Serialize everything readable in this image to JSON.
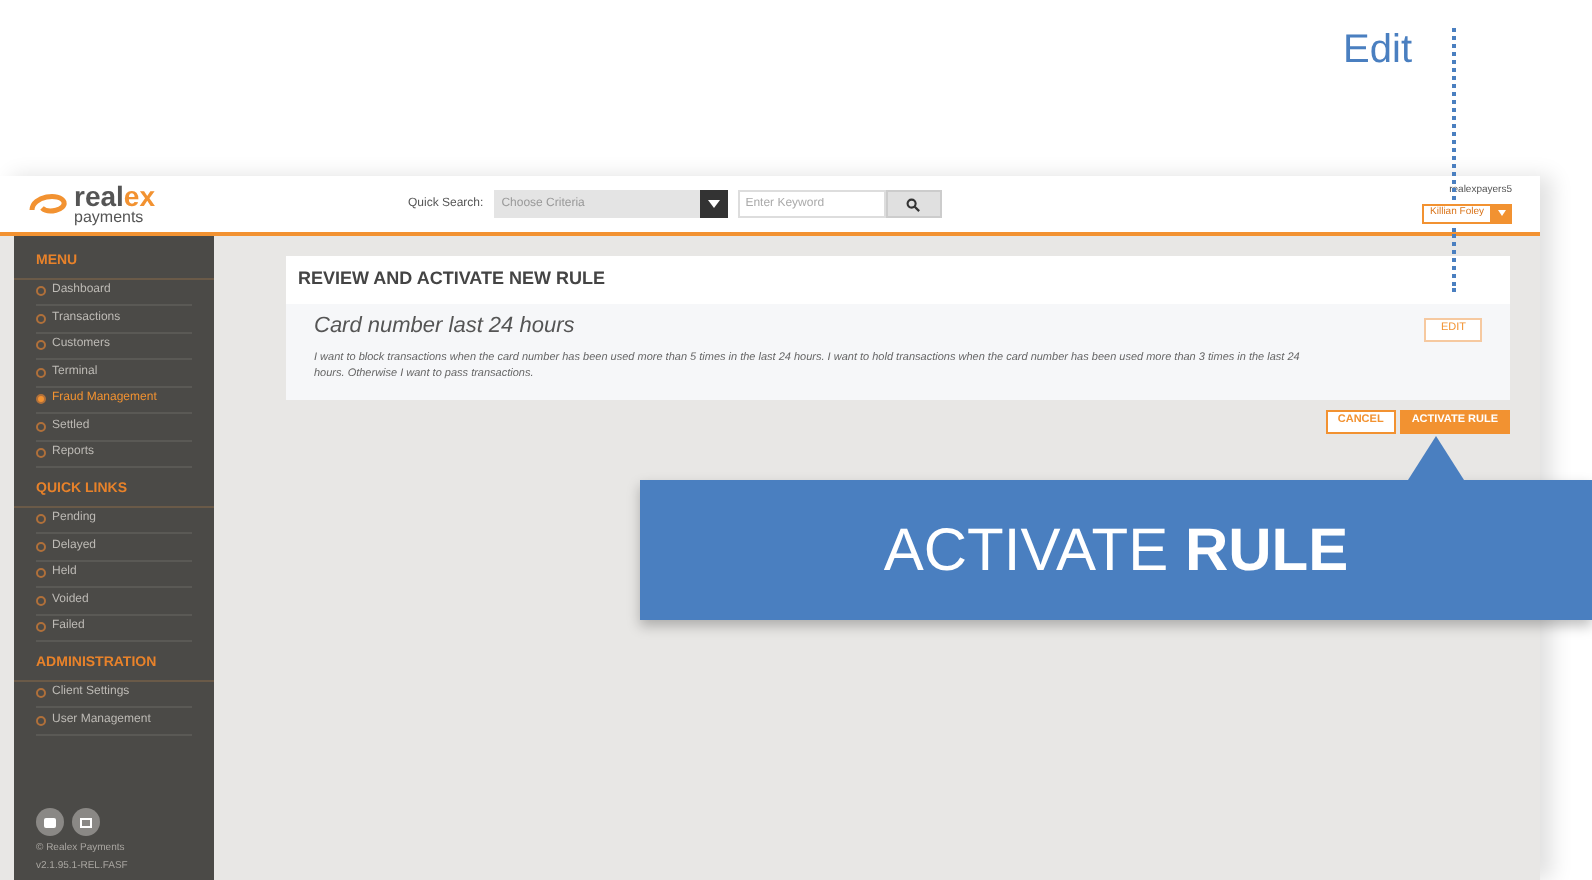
{
  "annotation": {
    "edit_label": "Edit"
  },
  "header": {
    "logo_main": "real",
    "logo_accent": "ex",
    "logo_sub": "payments",
    "quick_search_label": "Quick Search:",
    "criteria_placeholder": "Choose Criteria",
    "keyword_placeholder": "Enter Keyword",
    "username": "realexpayers5",
    "user_button": "Killian Foley"
  },
  "sidebar": {
    "sections": [
      {
        "title": "MENU",
        "items": [
          {
            "label": "Dashboard",
            "selected": false
          },
          {
            "label": "Transactions",
            "selected": false
          },
          {
            "label": "Customers",
            "selected": false
          },
          {
            "label": "Terminal",
            "selected": false
          },
          {
            "label": "Fraud Management",
            "selected": true
          },
          {
            "label": "Settled",
            "selected": false
          },
          {
            "label": "Reports",
            "selected": false
          }
        ]
      },
      {
        "title": "QUICK LINKS",
        "items": [
          {
            "label": "Pending",
            "selected": false
          },
          {
            "label": "Delayed",
            "selected": false
          },
          {
            "label": "Held",
            "selected": false
          },
          {
            "label": "Voided",
            "selected": false
          },
          {
            "label": "Failed",
            "selected": false
          }
        ]
      },
      {
        "title": "ADMINISTRATION",
        "items": [
          {
            "label": "Client Settings",
            "selected": false
          },
          {
            "label": "User Management",
            "selected": false
          }
        ]
      }
    ],
    "copyright": "© Realex Payments",
    "version": "v2.1.95.1-REL.FASF"
  },
  "panel": {
    "title": "REVIEW AND ACTIVATE NEW RULE",
    "rule_name": "Card number last 24 hours",
    "description": "I want to block transactions when the card number has been used more than 5 times in the last 24 hours. I want to hold transactions when the card number has been used more than 3 times in the last 24 hours. Otherwise I want to pass transactions.",
    "edit_button": "EDIT"
  },
  "actions": {
    "cancel": "CANCEL",
    "activate": "ACTIVATE RULE"
  },
  "callout": {
    "text": "ACTIVATE **RULE**"
  }
}
